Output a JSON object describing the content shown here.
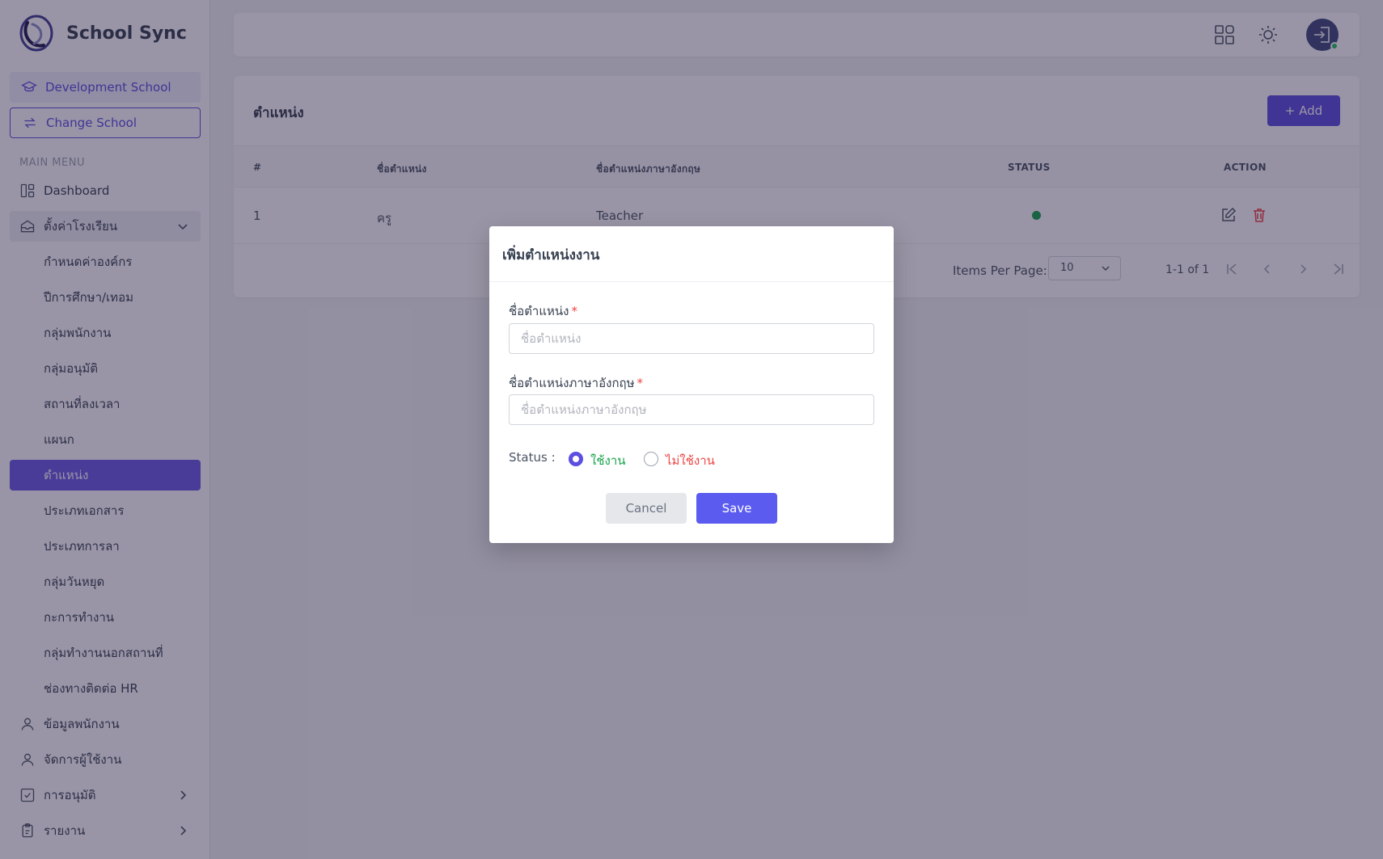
{
  "app": {
    "name": "School Sync"
  },
  "sidebar": {
    "school_name": "Development School",
    "change_school_label": "Change School",
    "menu_heading": "MAIN MENU",
    "items": [
      {
        "label": "Dashboard",
        "icon": "dashboard-icon"
      },
      {
        "label": "ตั้งค่าโรงเรียน",
        "icon": "school-icon",
        "expanded": true
      },
      {
        "label": "กำหนดค่าองค์กร"
      },
      {
        "label": "ปีการศึกษา/เทอม"
      },
      {
        "label": "กลุ่มพนักงาน"
      },
      {
        "label": "กลุ่มอนุมัติ"
      },
      {
        "label": "สถานที่ลงเวลา"
      },
      {
        "label": "แผนก"
      },
      {
        "label": "ตำแหน่ง",
        "active": true
      },
      {
        "label": "ประเภทเอกสาร"
      },
      {
        "label": "ประเภทการลา"
      },
      {
        "label": "กลุ่มวันหยุด"
      },
      {
        "label": "กะการทำงาน"
      },
      {
        "label": "กลุ่มทำงานนอกสถานที่"
      },
      {
        "label": "ช่องทางติดต่อ HR"
      },
      {
        "label": "ข้อมูลพนักงาน",
        "icon": "user-icon"
      },
      {
        "label": "จัดการผู้ใช้งาน",
        "icon": "user-icon"
      },
      {
        "label": "การอนุมัติ",
        "icon": "checkbox-icon"
      },
      {
        "label": "รายงาน",
        "icon": "clipboard-icon"
      }
    ]
  },
  "page": {
    "title": "ตำแหน่ง",
    "add_label": "+ Add",
    "table": {
      "headers": [
        "#",
        "ชื่อตำแหน่ง",
        "ชื่อตำแหน่งภาษาอังกฤษ",
        "STATUS",
        "ACTION"
      ],
      "rows": [
        {
          "index": "1",
          "name": "ครู",
          "name_en": "Teacher",
          "status": "active"
        }
      ]
    },
    "pagination": {
      "items_per_page_label": "Items Per Page:",
      "items_per_page_value": "10",
      "range": "1-1 of 1"
    }
  },
  "modal": {
    "title": "เพิ่มตำแหน่งงาน",
    "name_label": "ชื่อตำแหน่ง",
    "name_placeholder": "ชื่อตำแหน่ง",
    "name_en_label": "ชื่อตำแหน่งภาษาอังกฤษ",
    "name_en_placeholder": "ชื่อตำแหน่งภาษาอังกฤษ",
    "required_mark": "*",
    "status_label": "Status :",
    "status_on": "ใช้งาน",
    "status_off": "ไม่ใช้งาน",
    "cancel_label": "Cancel",
    "save_label": "Save"
  },
  "colors": {
    "primary": "#5b4ee0",
    "success": "#16a34a",
    "danger": "#ef4444"
  }
}
